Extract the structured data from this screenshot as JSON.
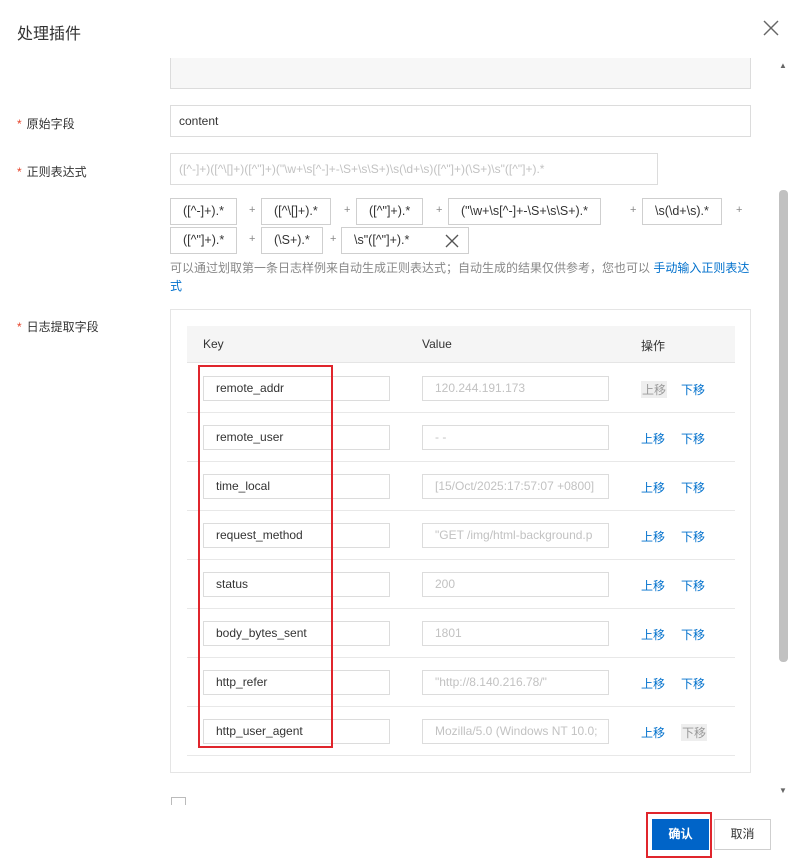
{
  "dialog": {
    "title": "处理插件"
  },
  "form": {
    "raw_field": {
      "label": "原始字段",
      "value": "content"
    },
    "regex": {
      "label": "正则表达式",
      "placeholder": "([^-]+)([^\\[]+)([^\"]+)(\"\\w+\\s[^-]+-\\S+\\s\\S+)\\s(\\d+\\s)([^\"]+)(\\S+)\\s\"([^\"]+).*",
      "tokens": [
        "([^-]+).*",
        "([^\\[]+).*",
        "([^\"]+).*",
        "(\"\\w+\\s[^-]+-\\S+\\s\\S+).*",
        "\\s(\\d+\\s).*",
        "([^\"]+).*",
        "(\\S+).*",
        "\\s\"([^\"]+).*"
      ],
      "plus": "+",
      "hint": "可以通过划取第一条日志样例来自动生成正则表达式；自动生成的结果仅供参考，您也可以",
      "hint_link": "手动输入正则表达式"
    },
    "extract": {
      "label": "日志提取字段",
      "columns": {
        "key": "Key",
        "value": "Value",
        "action": "操作"
      },
      "up_label": "上移",
      "down_label": "下移",
      "rows": [
        {
          "key": "remote_addr",
          "value": "120.244.191.173"
        },
        {
          "key": "remote_user",
          "value": "- -"
        },
        {
          "key": "time_local",
          "value": "[15/Oct/2025:17:57:07 +0800]"
        },
        {
          "key": "request_method",
          "value": "\"GET /img/html-background.p"
        },
        {
          "key": "status",
          "value": "200"
        },
        {
          "key": "body_bytes_sent",
          "value": "1801"
        },
        {
          "key": "http_refer",
          "value": "\"http://8.140.216.78/\""
        },
        {
          "key": "http_user_agent",
          "value": "Mozilla/5.0 (Windows NT 10.0;"
        }
      ]
    }
  },
  "footer": {
    "confirm_label": "确认",
    "cancel_label": "取消"
  },
  "colors": {
    "primary": "#0064c8",
    "link": "#0070cc",
    "required": "#e6452c",
    "highlight": "#e0252c"
  }
}
